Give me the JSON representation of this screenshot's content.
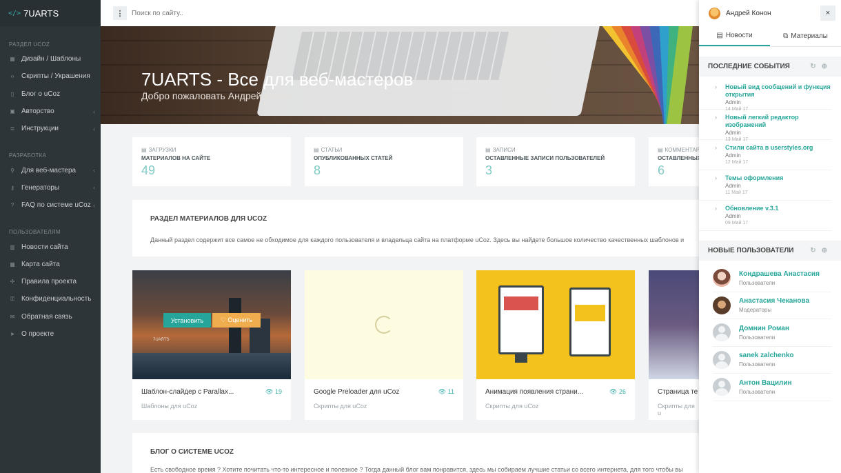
{
  "brand": {
    "code": "</>",
    "name": "7UARTS"
  },
  "sidebar": {
    "groups": [
      {
        "title": "Раздел uCoz",
        "items": [
          {
            "label": "Дизайн / Шаблоны",
            "icon": "grid-icon",
            "chev": false
          },
          {
            "label": "Скрипты / Украшения",
            "icon": "code-icon",
            "chev": false
          },
          {
            "label": "Блог о uCoz",
            "icon": "book-icon",
            "chev": false
          },
          {
            "label": "Авторство",
            "icon": "user-card-icon",
            "chev": true
          },
          {
            "label": "Инструкции",
            "icon": "list-icon",
            "chev": true
          }
        ]
      },
      {
        "title": "Разработка",
        "items": [
          {
            "label": "Для веб-мастера",
            "icon": "wrench-icon",
            "chev": true
          },
          {
            "label": "Генераторы",
            "icon": "key-icon",
            "chev": true
          },
          {
            "label": "FAQ по системе uCoz",
            "icon": "question-icon",
            "chev": true
          }
        ]
      },
      {
        "title": "Пользователям",
        "items": [
          {
            "label": "Новости сайта",
            "icon": "news-icon",
            "chev": false
          },
          {
            "label": "Карта сайта",
            "icon": "map-icon",
            "chev": false
          },
          {
            "label": "Правила проекта",
            "icon": "rules-icon",
            "chev": false
          },
          {
            "label": "Конфиденциальность",
            "icon": "lock-icon",
            "chev": false
          },
          {
            "label": "Обратная связь",
            "icon": "mail-icon",
            "chev": false
          },
          {
            "label": "О проекте",
            "icon": "send-icon",
            "chev": false
          }
        ]
      }
    ]
  },
  "topbar": {
    "search_placeholder": "Поиск по сайту.."
  },
  "hero": {
    "title": "7UARTS - Все для веб-мастеров",
    "subtitle": "Добро пожаловать Андрей Конон."
  },
  "stats": [
    {
      "cap": "Загрузки",
      "label": "Материалов на сайте",
      "value": "49"
    },
    {
      "cap": "Статьи",
      "label": "Опубликованных статей",
      "value": "8"
    },
    {
      "cap": "Записи",
      "label": "Оставленные записи пользователей",
      "value": "3"
    },
    {
      "cap": "Комментари",
      "label": "Оставленных",
      "value": "6"
    }
  ],
  "section": {
    "title": "Раздел материалов для uCoz",
    "text": "Данный раздел содержит все самое не обходимое для каждого пользователя и владельца сайта на платформе uCoz. Здесь вы найдете большое количество качественных шаблонов и"
  },
  "cards": [
    {
      "title": "Шаблон-слайдер с Parallax...",
      "views": "19",
      "category": "Шаблоны для uCoz",
      "install": "Установить",
      "rate": "♡ Оценить",
      "img_text": "7UARTS"
    },
    {
      "title": "Google Preloader для uCoz",
      "views": "11",
      "category": "Скрипты для uCoz"
    },
    {
      "title": "Анимация появления страни...",
      "views": "26",
      "category": "Скрипты для uCoz"
    },
    {
      "title": "Страница те",
      "views": "",
      "category": "Скрипты для u"
    }
  ],
  "blog": {
    "title": "Блог о системе uCoz",
    "text": "Есть свободное время ? Хотите почитать что-то интересное и полезное ? Тогда данный блог вам понравится, здесь мы собираем лучшие статьи со всего интернета, для того чтобы вы"
  },
  "panel": {
    "user": "Андрей Конон",
    "close": "×",
    "tabs": [
      {
        "label": "Новости",
        "icon": "newspaper-icon"
      },
      {
        "label": "Материалы",
        "icon": "copy-icon"
      }
    ],
    "events_title": "Последние события",
    "events": [
      {
        "title": "Новый вид сообщений и функция открытия",
        "author": "Admin",
        "date": "14 Май 17"
      },
      {
        "title": "Новый легкий редактор изображений",
        "author": "Admin",
        "date": "13 Май 17"
      },
      {
        "title": "Стили сайта в userstyles.org",
        "author": "Admin",
        "date": "12 Май 17"
      },
      {
        "title": "Темы оформления",
        "author": "Admin",
        "date": "11 Май 17"
      },
      {
        "title": "Обновление v.3.1",
        "author": "Admin",
        "date": "09 Май 17"
      }
    ],
    "users_title": "Новые пользователи",
    "users": [
      {
        "name": "Кондрашева Анастасия",
        "role": "Пользователи",
        "avatar": "photo"
      },
      {
        "name": "Анастасия Чеканова",
        "role": "Модераторы",
        "avatar": "photo"
      },
      {
        "name": "Домнин Роман",
        "role": "Пользователи",
        "avatar": "generic"
      },
      {
        "name": "sanek zalchenko",
        "role": "Пользователи",
        "avatar": "generic"
      },
      {
        "name": "Антон Вацилин",
        "role": "Пользователи",
        "avatar": "generic"
      }
    ]
  },
  "colors": {
    "accent": "#26a69a",
    "sidebar": "#2d3539",
    "rate": "#f0ad4e"
  }
}
